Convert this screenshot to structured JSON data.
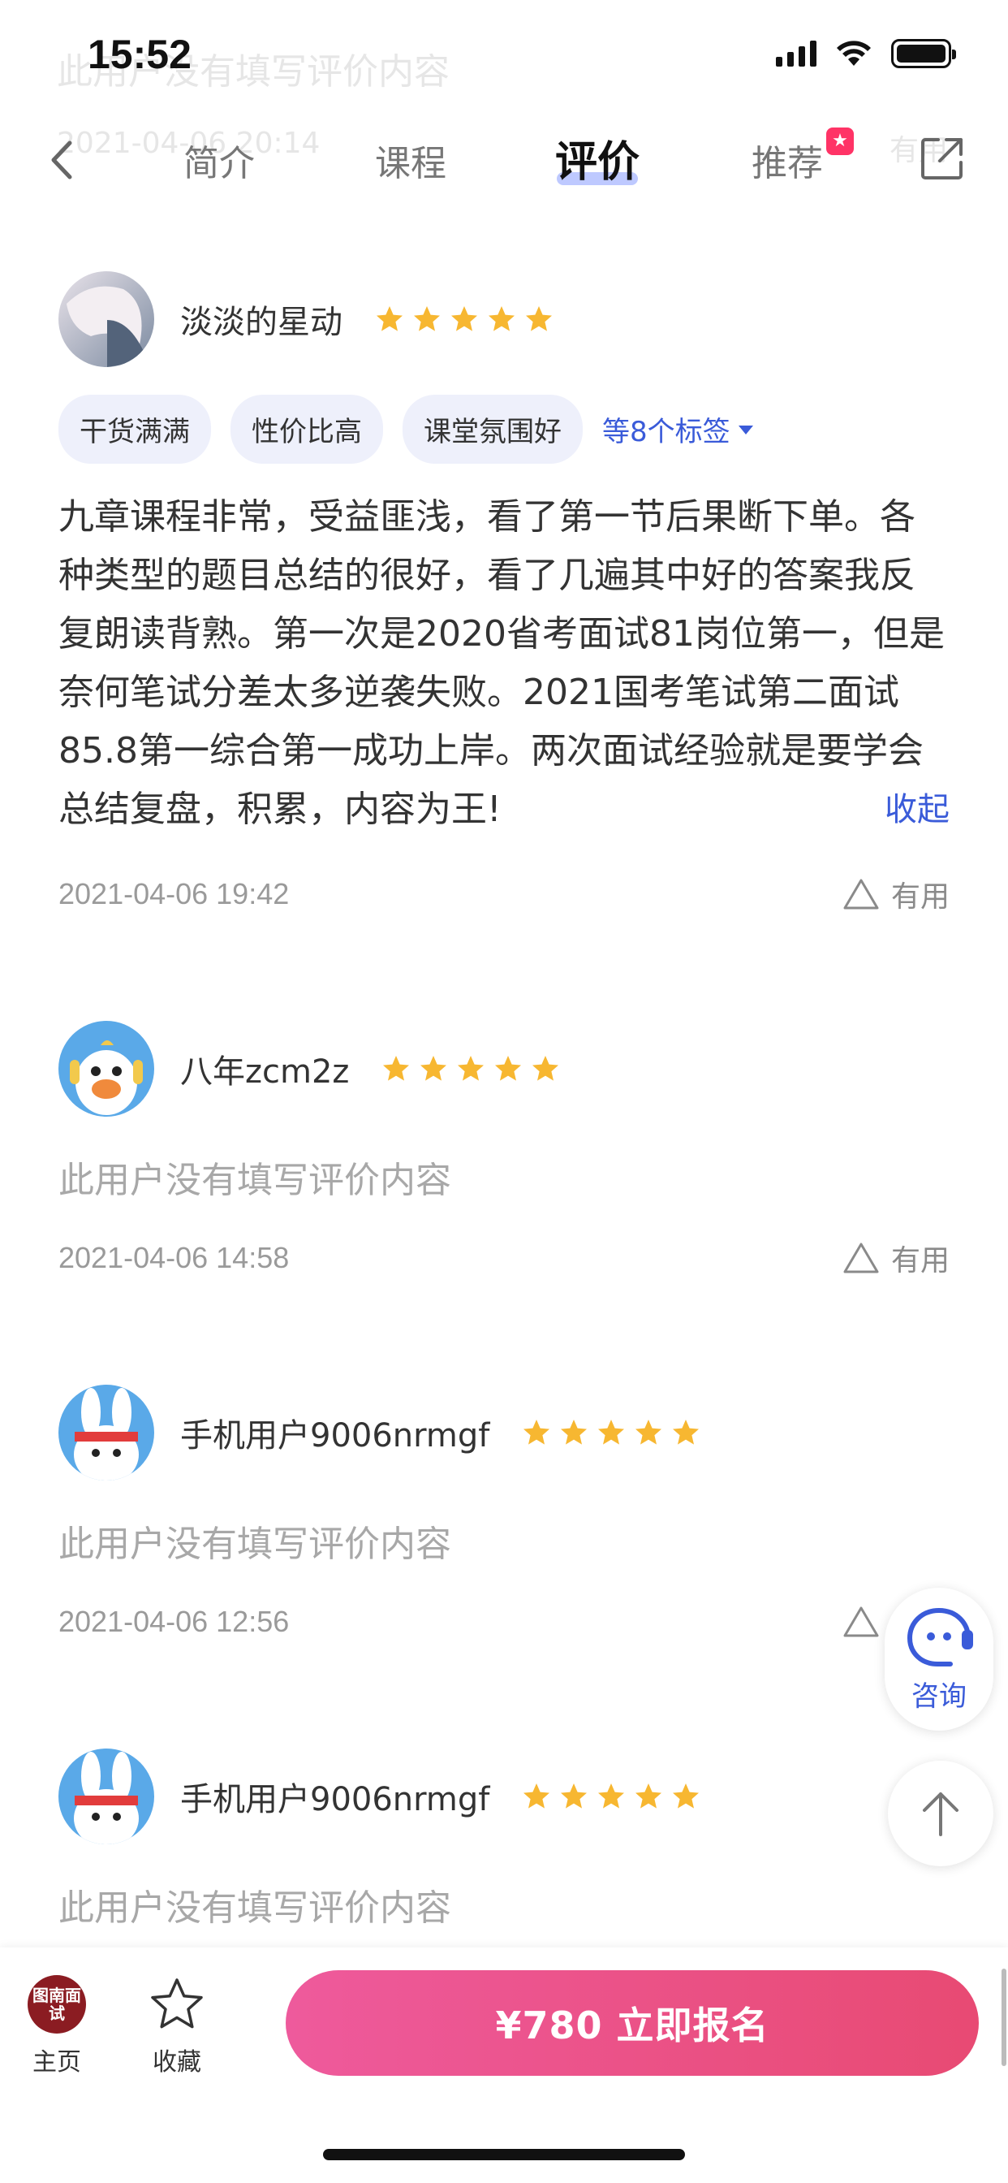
{
  "status_bar": {
    "time": "15:52"
  },
  "nav": {
    "tabs": [
      {
        "label": "简介"
      },
      {
        "label": "课程"
      },
      {
        "label": "评价"
      },
      {
        "label": "推荐"
      }
    ],
    "ghost_text": "此用户没有填写评价内容",
    "ghost_date": "2021-04-06 20:14",
    "ghost_useful": "有用"
  },
  "reviews": [
    {
      "username": "淡淡的星动",
      "rating": 5,
      "tags": [
        "干货满满",
        "性价比高",
        "课堂氛围好"
      ],
      "tags_more": "等8个标签",
      "text": "九章课程非常，受益匪浅，看了第一节后果断下单。各种类型的题目总结的很好，看了几遍其中好的答案我反复朗读背熟。第一次是2020省考面试81岗位第一，但是奈何笔试分差太多逆袭失败。2021国考笔试第二面试85.8第一综合第一成功上岸。两次面试经验就是要学会总结复盘，积累，内容为王!",
      "collapse_label": "收起",
      "date": "2021-04-06 19:42",
      "useful_label": "有用"
    },
    {
      "username": "八年zcm2z",
      "rating": 5,
      "text": "此用户没有填写评价内容",
      "date": "2021-04-06 14:58",
      "useful_label": "有用"
    },
    {
      "username": "手机用户9006nrmgf",
      "rating": 5,
      "text": "此用户没有填写评价内容",
      "date": "2021-04-06 12:56",
      "useful_label": "有用"
    },
    {
      "username": "手机用户9006nrmgf",
      "rating": 5,
      "text": "此用户没有填写评价内容"
    }
  ],
  "floating": {
    "consult_label": "咨询"
  },
  "bottom_bar": {
    "home_logo_text": "图南面试",
    "home_label": "主页",
    "favorite_label": "收藏",
    "enroll_label": "¥780  立即报名"
  },
  "colors": {
    "accent_blue": "#3a5bd9",
    "star_yellow": "#f7b731",
    "enroll_gradient_start": "#ee5a9c",
    "enroll_gradient_end": "#e84a73"
  }
}
